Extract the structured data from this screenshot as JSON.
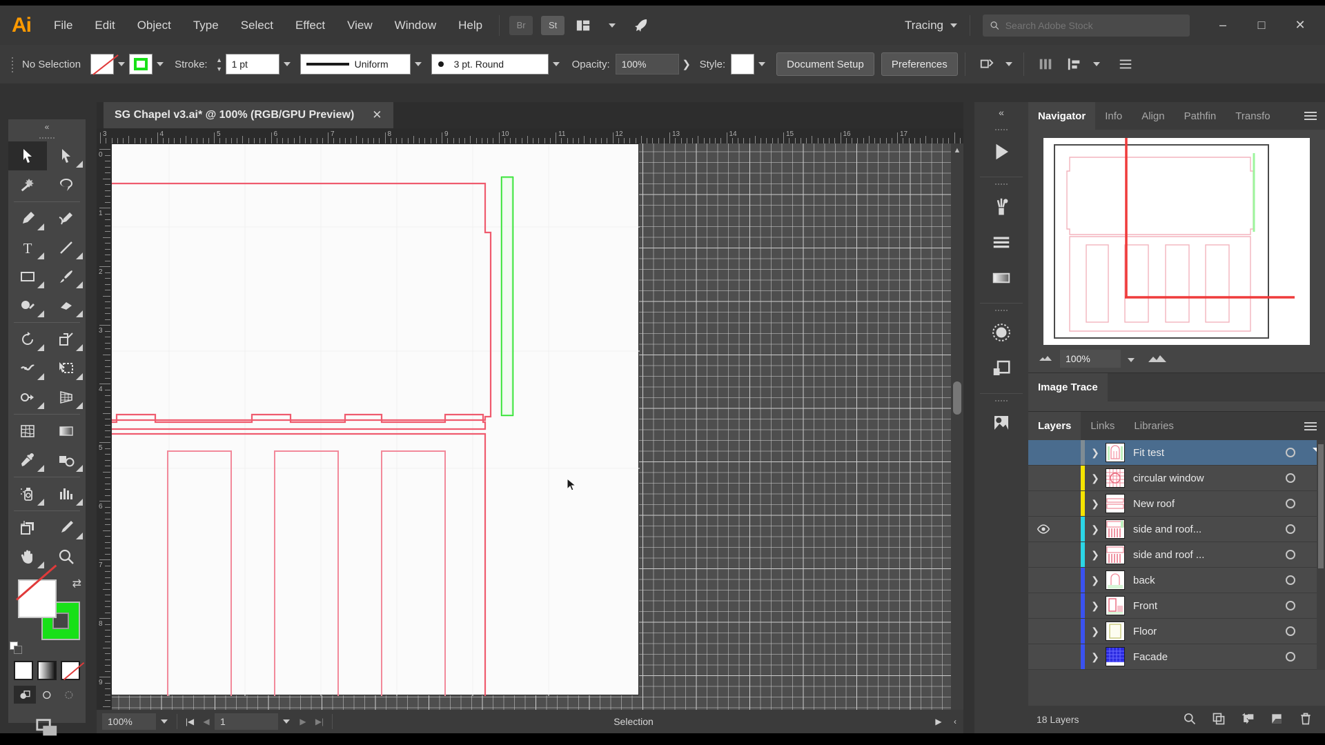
{
  "app": {
    "name": "Adobe Illustrator",
    "logo": "Ai"
  },
  "menubar": {
    "items": [
      "File",
      "Edit",
      "Object",
      "Type",
      "Select",
      "Effect",
      "View",
      "Window",
      "Help"
    ],
    "bridge_label": "Br",
    "stock_label": "St",
    "arrange_icon": "arrange-documents-icon",
    "rocket_icon": "discover-rocket-icon",
    "workspace": "Tracing",
    "search_placeholder": "Search Adobe Stock",
    "search_value": "",
    "window_minimize": "–",
    "window_maximize": "□",
    "window_close": "✕"
  },
  "controlbar": {
    "selection_label": "No Selection",
    "fill_swatch": "none",
    "stroke_swatch": "#00ff00",
    "stroke_label": "Stroke:",
    "stroke_weight": "1 pt",
    "profile_label": "Uniform",
    "brush_label": "3 pt. Round",
    "opacity_label": "Opacity:",
    "opacity_value": "100%",
    "opacity_more": "❯",
    "style_label": "Style:",
    "document_setup": "Document Setup",
    "preferences": "Preferences",
    "align_icon": "align-icon",
    "distribute_icon": "distribute-icon",
    "transform_icon": "transform-icon",
    "options_icon": "more-options-icon"
  },
  "toolbar": {
    "tools": [
      {
        "name": "selection-tool",
        "selected": true,
        "corner": false
      },
      {
        "name": "direct-selection-tool",
        "selected": false,
        "corner": true
      },
      {
        "name": "magic-wand-tool",
        "selected": false,
        "corner": false
      },
      {
        "name": "lasso-tool",
        "selected": false,
        "corner": false
      },
      {
        "name": "pen-tool",
        "selected": false,
        "corner": true
      },
      {
        "name": "curvature-tool",
        "selected": false,
        "corner": false
      },
      {
        "name": "type-tool",
        "selected": false,
        "corner": true
      },
      {
        "name": "line-segment-tool",
        "selected": false,
        "corner": true
      },
      {
        "name": "rectangle-tool",
        "selected": false,
        "corner": true
      },
      {
        "name": "paintbrush-tool",
        "selected": false,
        "corner": true
      },
      {
        "name": "shaper-tool",
        "selected": false,
        "corner": true
      },
      {
        "name": "eraser-tool",
        "selected": false,
        "corner": true
      },
      {
        "name": "rotate-tool",
        "selected": false,
        "corner": true
      },
      {
        "name": "scale-tool",
        "selected": false,
        "corner": true
      },
      {
        "name": "width-tool",
        "selected": false,
        "corner": true
      },
      {
        "name": "free-transform-tool",
        "selected": false,
        "corner": true
      },
      {
        "name": "shape-builder-tool",
        "selected": false,
        "corner": true
      },
      {
        "name": "perspective-grid-tool",
        "selected": false,
        "corner": true
      },
      {
        "name": "mesh-tool",
        "selected": false,
        "corner": false
      },
      {
        "name": "gradient-tool",
        "selected": false,
        "corner": false
      },
      {
        "name": "eyedropper-tool",
        "selected": false,
        "corner": true
      },
      {
        "name": "blend-tool",
        "selected": false,
        "corner": true
      },
      {
        "name": "symbol-sprayer-tool",
        "selected": false,
        "corner": true
      },
      {
        "name": "column-graph-tool",
        "selected": false,
        "corner": true
      },
      {
        "name": "artboard-tool",
        "selected": false,
        "corner": false
      },
      {
        "name": "slice-tool",
        "selected": false,
        "corner": true
      },
      {
        "name": "hand-tool",
        "selected": false,
        "corner": true
      },
      {
        "name": "zoom-tool",
        "selected": false,
        "corner": false
      }
    ],
    "fill_color": "none",
    "stroke_color": "#00ff00",
    "modes": [
      "color",
      "gradient",
      "none"
    ],
    "draw_modes": [
      "draw-normal",
      "draw-behind",
      "draw-inside"
    ],
    "screen_mode": "change-screen-mode"
  },
  "document": {
    "tab_title": "SG Chapel v3.ai* @ 100% (RGB/GPU Preview)",
    "close_label": "✕",
    "ruler_h_labels": [
      "3",
      "4",
      "5",
      "6",
      "7",
      "8",
      "9",
      "10",
      "11",
      "12",
      "13",
      "14",
      "15",
      "16",
      "17"
    ],
    "ruler_v_labels": [
      "0",
      "1",
      "2",
      "3",
      "4",
      "5",
      "6",
      "7",
      "8",
      "9"
    ]
  },
  "statusbar": {
    "zoom": "100%",
    "artboard_number": "1",
    "status_text": "Selection",
    "first_icon": "first-artboard-icon",
    "prev_icon": "previous-artboard-icon",
    "next_icon": "next-artboard-icon",
    "last_icon": "last-artboard-icon"
  },
  "dockrail": {
    "buttons": [
      {
        "name": "play-tool-panel-icon"
      },
      {
        "name": "brushes-panel-icon"
      },
      {
        "name": "stroke-panel-icon"
      },
      {
        "name": "gradient-panel-icon"
      },
      {
        "name": "symbols-panel-icon"
      },
      {
        "name": "layers-panel-icon"
      },
      {
        "name": "image-trace-panel-icon"
      }
    ],
    "collapse_label": "«"
  },
  "navigator": {
    "tabs": [
      "Navigator",
      "Info",
      "Align",
      "Pathfin",
      "Transfo"
    ],
    "active_tab": "Navigator",
    "zoom_value": "100%",
    "zoom_out_icon": "zoom-out-icon",
    "zoom_in_icon": "zoom-in-icon",
    "menu_icon": "panel-menu-icon"
  },
  "image_trace": {
    "tabs": [
      "Image Trace"
    ],
    "active_tab": "Image Trace"
  },
  "layers_panel": {
    "tabs": [
      "Layers",
      "Links",
      "Libraries"
    ],
    "active_tab": "Layers",
    "menu_icon": "panel-menu-icon",
    "footer_count": "18 Layers",
    "footer_icons": [
      "locate-object-icon",
      "make-mask-icon",
      "create-sublayer-icon",
      "create-new-layer-icon",
      "delete-selection-icon"
    ],
    "rows": [
      {
        "name": "Fit test",
        "color": "#7f8c94",
        "visible": false,
        "selected": true
      },
      {
        "name": "circular window",
        "color": "#f5e400",
        "visible": false,
        "selected": false
      },
      {
        "name": "New roof",
        "color": "#f5e400",
        "visible": false,
        "selected": false
      },
      {
        "name": "side and roof...",
        "color": "#2bd6e6",
        "visible": true,
        "selected": false
      },
      {
        "name": "side and roof ...",
        "color": "#2bd6e6",
        "visible": false,
        "selected": false
      },
      {
        "name": "back",
        "color": "#3a52f0",
        "visible": false,
        "selected": false
      },
      {
        "name": "Front",
        "color": "#3a52f0",
        "visible": false,
        "selected": false
      },
      {
        "name": "Floor",
        "color": "#3a52f0",
        "visible": false,
        "selected": false
      },
      {
        "name": "Facade",
        "color": "#3a52f0",
        "visible": false,
        "selected": false
      }
    ]
  }
}
